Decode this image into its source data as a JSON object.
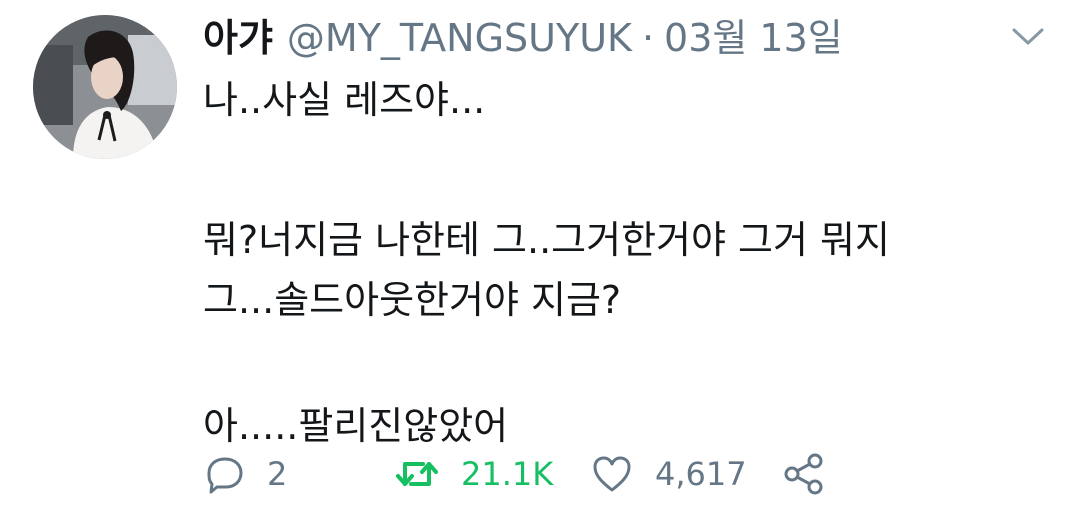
{
  "tweet": {
    "display_name": "아갸",
    "handle": "@MY_TANGSUYUK",
    "separator": "·",
    "timestamp": "03월 13일",
    "lines": {
      "l1": "나..사실 레즈야...",
      "l2": "뭐?너지금 나한테 그..그거한거야 그거 뭐지",
      "l3": "그...솔드아웃한거야 지금?",
      "l4": "아.....팔리진않았어"
    },
    "actions": {
      "replies": "2",
      "retweets": "21.1K",
      "likes": "4,617"
    }
  },
  "icons": {
    "caret": "chevron-down-icon",
    "reply": "reply-icon",
    "retweet": "retweet-icon",
    "like": "heart-icon",
    "share": "share-icon"
  },
  "colors": {
    "text": "#14171a",
    "muted": "#657786",
    "retweet_active": "#17bf63"
  }
}
